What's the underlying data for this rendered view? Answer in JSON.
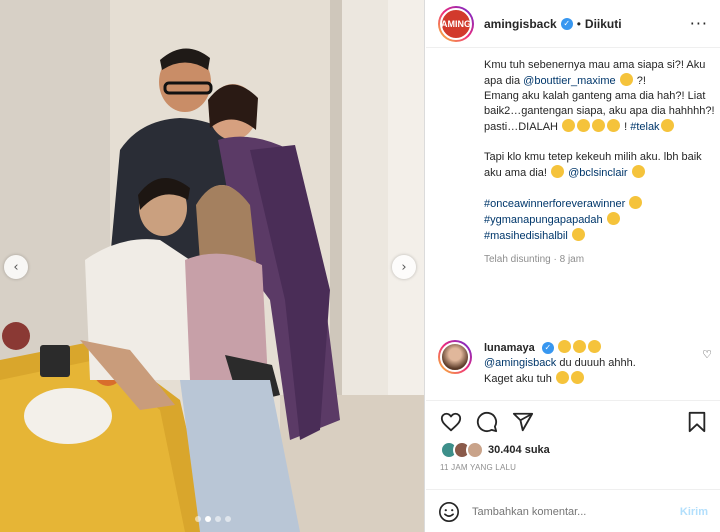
{
  "post": {
    "username": "amingisback",
    "separator": "•",
    "follow_status": "Diikuti",
    "avatar_text": "AMING",
    "caption": {
      "p1": {
        "t1": "Kmu tuh sebenernya mau ama siapa si?! Aku apa dia ",
        "mention": "@bouttier_maxime",
        "t2": " ?!"
      },
      "p2": {
        "t1": "Emang aku kalah ganteng ama dia hah?! Liat baik2…gantengan siapa, aku apa dia hahhhh?! pasti…DIALAH ",
        "t2": " ! ",
        "hashtag": "#telak"
      },
      "p3": {
        "t1": "Tapi klo kmu tetep kekeuh milih aku. lbh baik aku ama dia! ",
        "mention": "@bclsinclair"
      },
      "hashtags": [
        "#onceawinnerforeverawinner",
        "#ygmanapungapapadah",
        "#masihedisihalbil"
      ]
    },
    "edited_label": "Telah disunting · 8 jam",
    "likes": "30.404 suka",
    "timestamp": "11 JAM YANG LALU"
  },
  "comment": {
    "username": "lunamaya",
    "mention": "@amingisback",
    "text1": " du duuuh ahhh.",
    "text2": "Kaget aku tuh "
  },
  "comment_input": {
    "placeholder": "Tambahkan komentar...",
    "post_label": "Kirim"
  },
  "icons": [
    "more-options-icon",
    "heart-icon",
    "comment-icon",
    "share-icon",
    "bookmark-icon",
    "emoji-icon",
    "chevron-left-icon",
    "chevron-right-icon",
    "verified-icon"
  ],
  "colors": {
    "link": "#00376b",
    "verified": "#3897f0",
    "muted": "#8e8e8e",
    "post_button": "#b2dffc"
  },
  "carousel": {
    "total": 4,
    "active": 2
  }
}
